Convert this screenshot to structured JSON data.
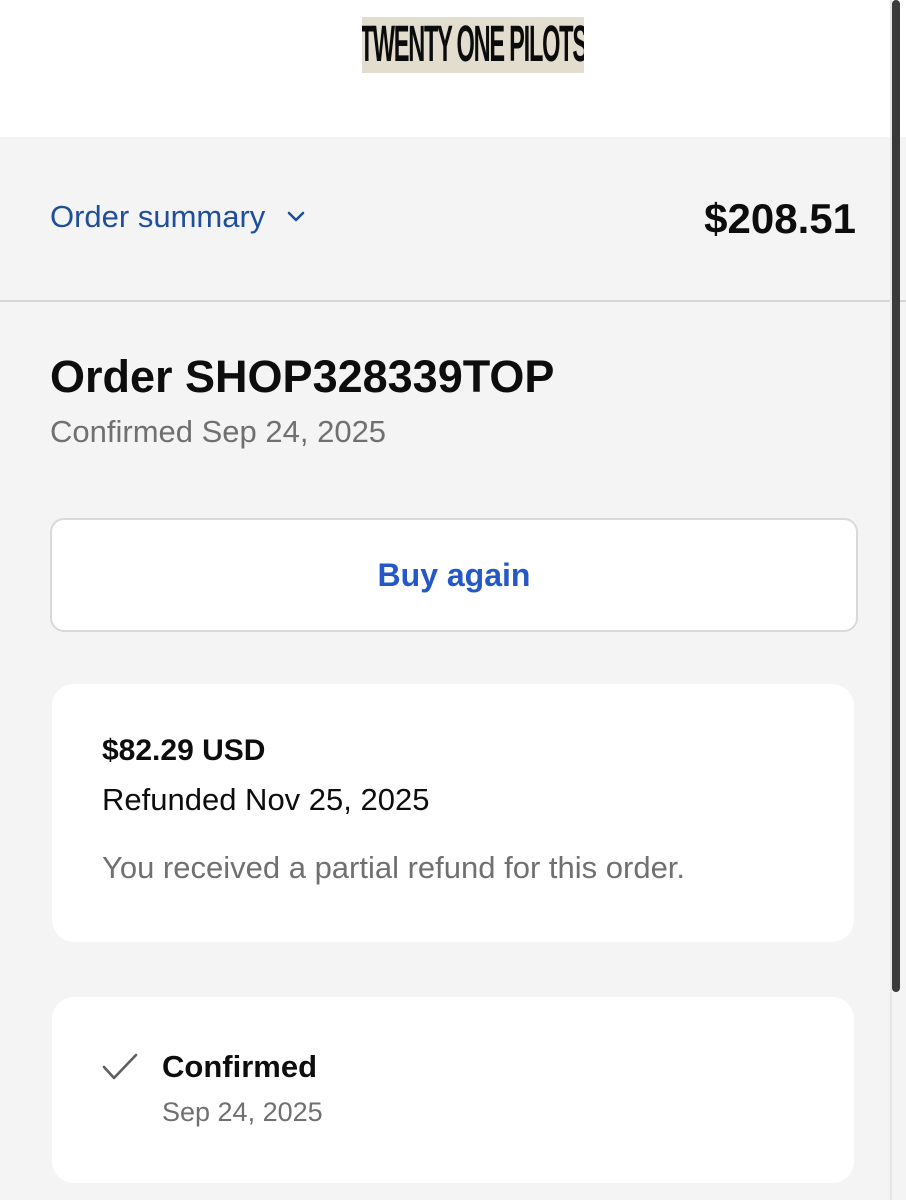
{
  "header": {
    "brand_logo_text": "TWENTY ONE PILOTS"
  },
  "summary": {
    "label": "Order summary",
    "toggle_icon": "chevron-down-icon",
    "total": "$208.51",
    "accent_color": "#1f4f9a"
  },
  "order": {
    "title": "Order SHOP328339TOP",
    "confirmed_text": "Confirmed Sep 24, 2025"
  },
  "actions": {
    "buy_again_label": "Buy again",
    "button_color": "#2458c6"
  },
  "refund": {
    "amount": "$82.29 USD",
    "date_text": "Refunded Nov 25, 2025",
    "note": "You received a partial refund for this order."
  },
  "status": {
    "icon": "checkmark-icon",
    "label": "Confirmed",
    "date": "Sep 24, 2025"
  }
}
